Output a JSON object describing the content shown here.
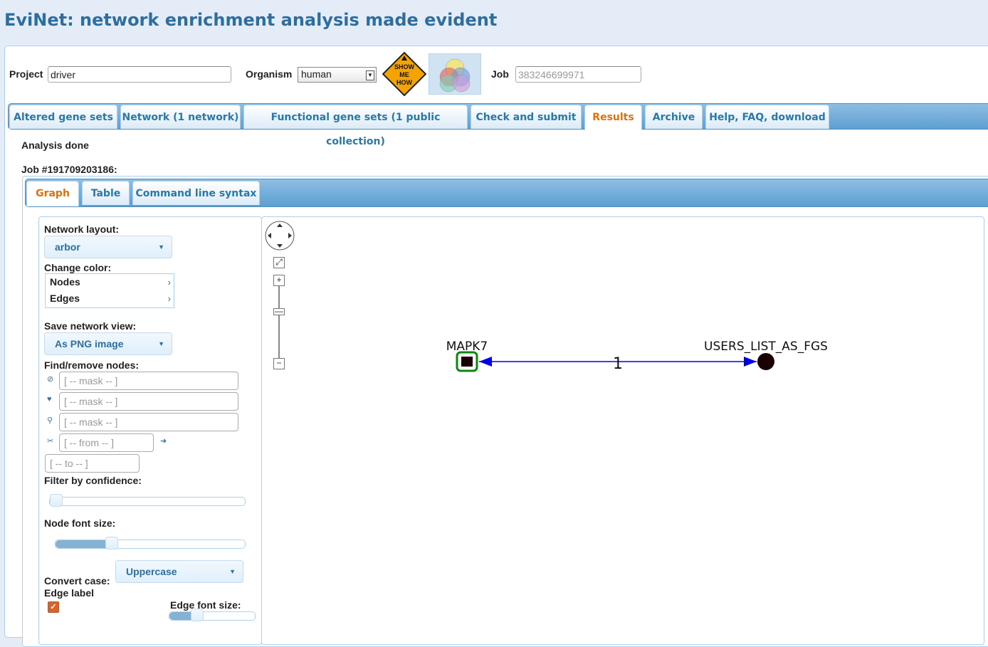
{
  "app": {
    "title": "EviNet: network enrichment analysis made evident"
  },
  "header": {
    "project_label": "Project",
    "project_value": "driver",
    "organism_label": "Organism",
    "organism_value": "human",
    "show_me_how_text": [
      "SHOW",
      "ME",
      "HOW"
    ],
    "job_label": "Job",
    "job_placeholder": "383246699971"
  },
  "main_tabs": [
    {
      "label": "Altered gene sets"
    },
    {
      "label": "Network (1 network)"
    },
    {
      "label": "Functional gene sets (1 public collection)"
    },
    {
      "label": "Check and submit"
    },
    {
      "label": "Results",
      "active": true
    },
    {
      "label": "Archive"
    },
    {
      "label": "Help, FAQ, download"
    }
  ],
  "results": {
    "status": "Analysis done",
    "job_heading": "Job #191709203186:",
    "sub_tabs": [
      {
        "label": "Graph",
        "active": true
      },
      {
        "label": "Table"
      },
      {
        "label": "Command line syntax"
      }
    ]
  },
  "controls": {
    "network_layout_label": "Network layout:",
    "network_layout_value": "arbor",
    "change_color_label": "Change color:",
    "color_menu": [
      "Nodes",
      "Edges"
    ],
    "save_view_label": "Save network view:",
    "save_view_value": "As PNG image",
    "find_remove_label": "Find/remove nodes:",
    "mask_placeholder": "[ -- mask -- ]",
    "from_placeholder": "[ -- from -- ]",
    "to_placeholder": "[ -- to -- ]",
    "filter_confidence_label": "Filter by confidence:",
    "filter_confidence_value": 0,
    "node_font_label": "Node font size:",
    "node_font_value": 0.3,
    "convert_case_label": "Convert case:",
    "convert_case_value": "Uppercase",
    "edge_label_label": "Edge label",
    "edge_label_checked": true,
    "edge_font_label": "Edge font size:",
    "edge_font_value": 0.3
  },
  "graph": {
    "nodes": [
      {
        "label": "MAPK7",
        "shape": "square",
        "color": "#1a0000",
        "border": "#0a8a0a"
      },
      {
        "label": "USERS_LIST_AS_FGS",
        "shape": "circle",
        "color": "#1a0000"
      }
    ],
    "edge": {
      "label": "1",
      "color": "#0000ee"
    }
  },
  "colors": {
    "accent": "#2e6e9e",
    "active_tab": "#e17009",
    "tab_bar": "#5d9fd1"
  }
}
